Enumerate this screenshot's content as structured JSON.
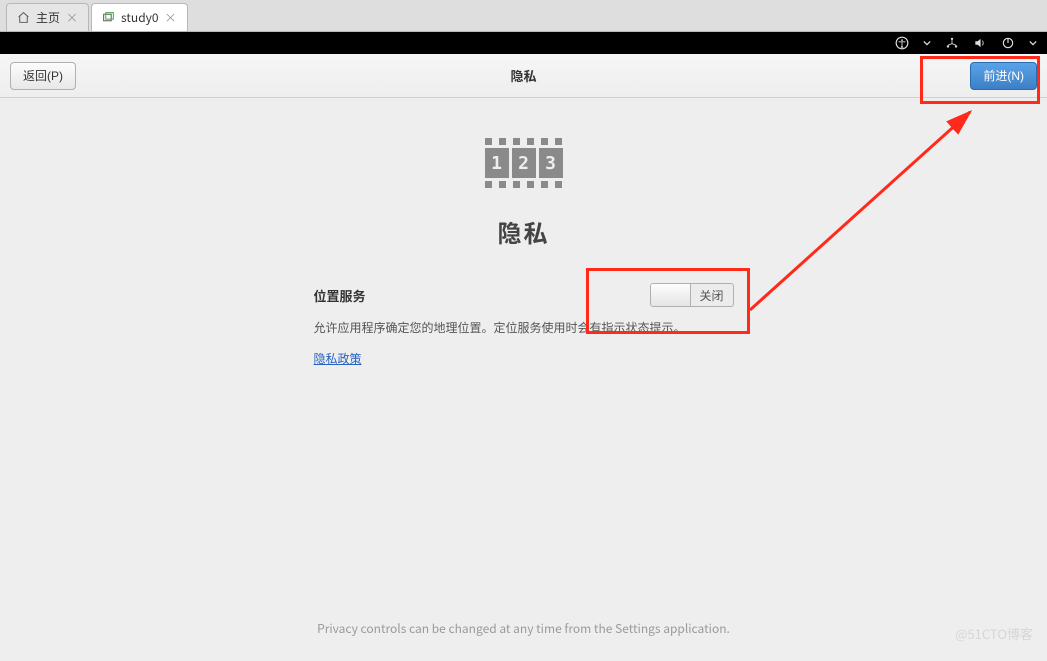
{
  "tabs": {
    "home": {
      "label": "主页"
    },
    "study": {
      "label": "study0"
    }
  },
  "header": {
    "back_label": "返回(P)",
    "title": "隐私",
    "forward_label": "前进(N)"
  },
  "privacy_icon": {
    "digits": [
      "1",
      "2",
      "3"
    ]
  },
  "main": {
    "title": "隐私",
    "setting_label": "位置服务",
    "toggle_state_label": "关闭",
    "description": "允许应用程序确定您的地理位置。定位服务使用时会有指示状态提示。",
    "policy_link": "隐私政策"
  },
  "footer": {
    "note": "Privacy controls can be changed at any time from the Settings application."
  },
  "watermark": "@51CTO博客"
}
